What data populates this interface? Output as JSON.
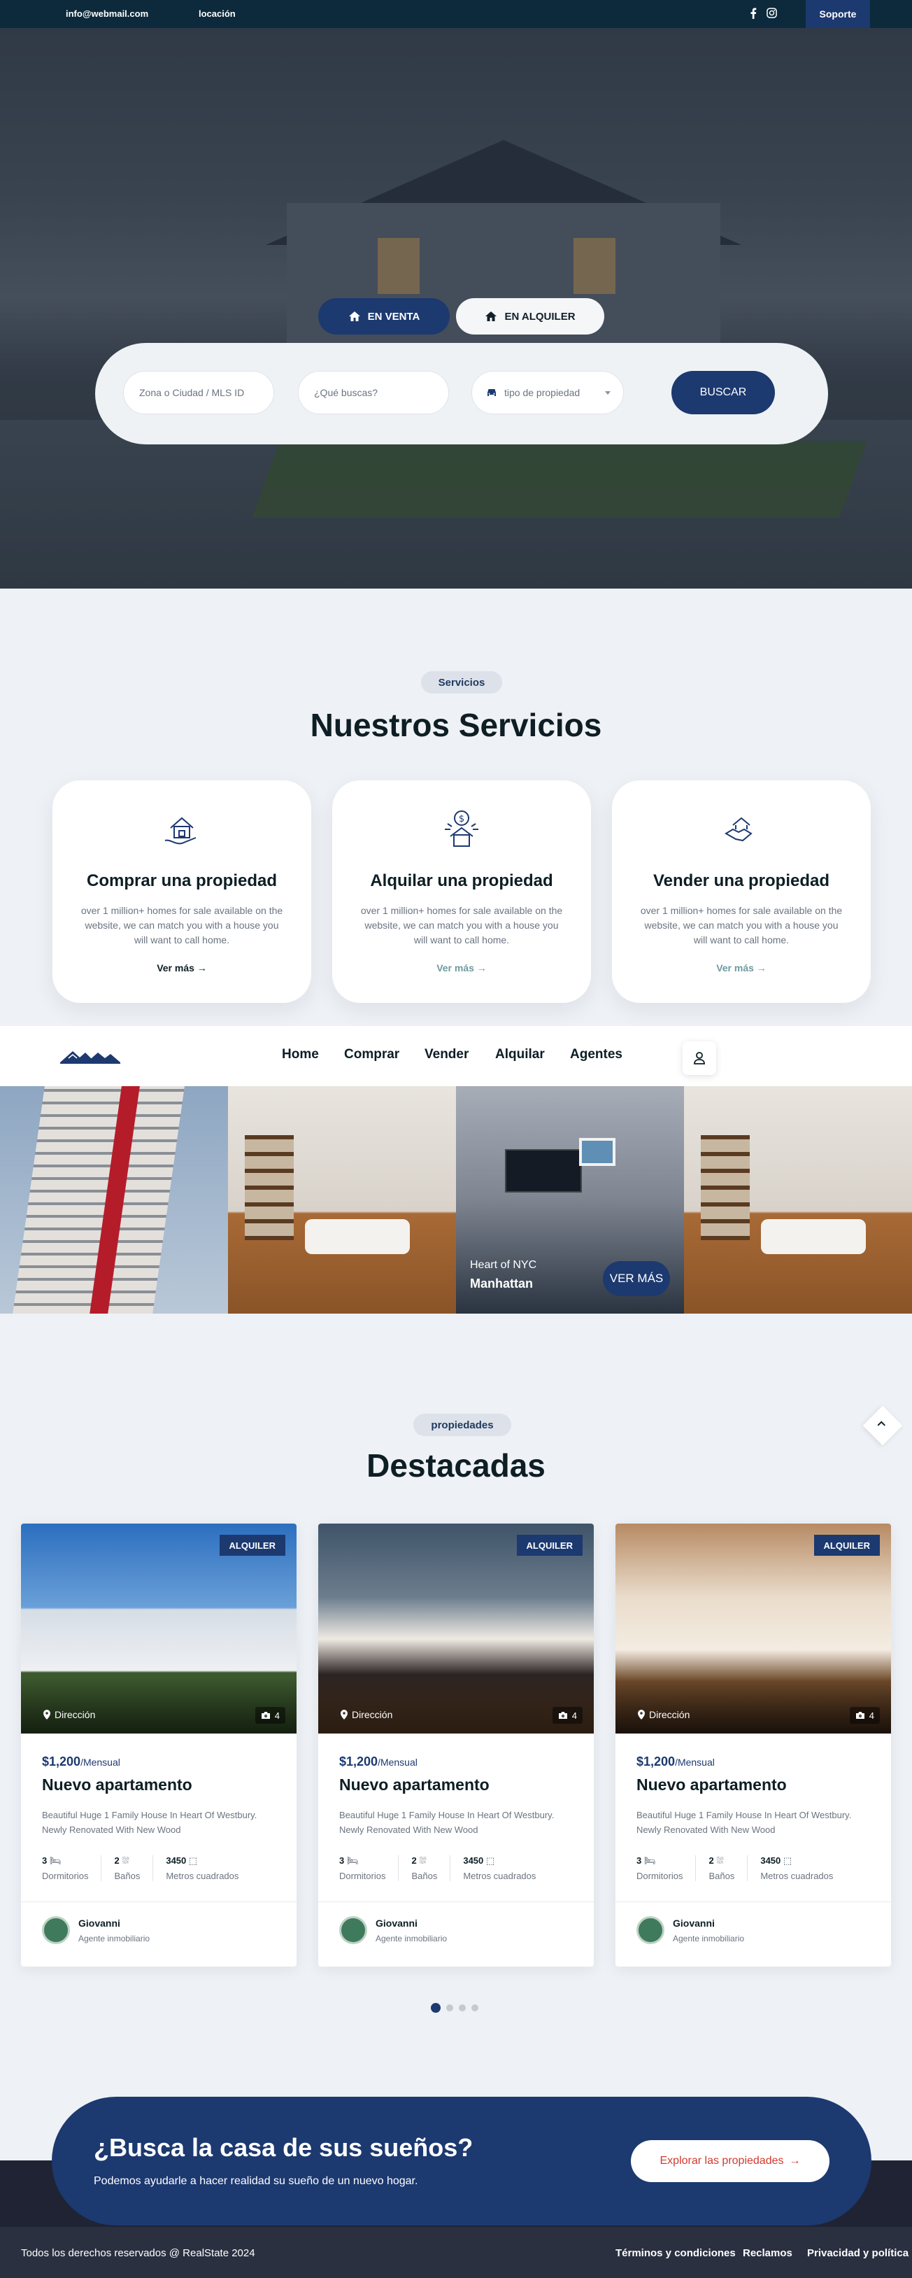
{
  "topbar": {
    "email": "info@webmail.com",
    "location": "locación",
    "support": "Soporte",
    "icons": [
      "mail-icon",
      "facebook-icon",
      "instagram-icon"
    ]
  },
  "hero": {
    "tab_sale": "EN VENTA",
    "tab_rent": "EN ALQUILER",
    "search": {
      "zone_placeholder": "Zona o Ciudad / MLS ID",
      "query_placeholder": "¿Qué buscas?",
      "property_type": "tipo de propiedad",
      "button": "BUSCAR"
    }
  },
  "services": {
    "pill": "Servicios",
    "title": "Nuestros Servicios",
    "cards": [
      {
        "title": "Comprar una propiedad",
        "desc": "over 1 million+ homes for sale available on the website, we can match you with a house you will want to call home.",
        "link": "Ver más"
      },
      {
        "title": "Alquilar una propiedad",
        "desc": "over 1 million+ homes for sale available on the website, we can match you with a house you will want to call home.",
        "link": "Ver más"
      },
      {
        "title": "Vender una propiedad",
        "desc": "over 1 million+ homes for sale available on the website, we can match you with a house you will want to call home.",
        "link": "Ver más"
      }
    ]
  },
  "nav": {
    "items": [
      "Home",
      "Comprar",
      "Vender",
      "Alquilar",
      "Agentes"
    ]
  },
  "gallery": {
    "caption_small": "Heart of NYC",
    "caption_big": "Manhattan",
    "button": "VER MÁS"
  },
  "featured": {
    "pill": "propiedades",
    "title": "Destacadas",
    "cards": [
      {
        "badge": "ALQUILER",
        "address": "Dirección",
        "photos": "4",
        "price": "$1,200",
        "period": "/Mensual",
        "title": "Nuevo apartamento",
        "desc": "Beautiful Huge 1 Family House In Heart Of Westbury. Newly Renovated With New Wood",
        "beds": "3",
        "beds_label": "Dormitorios",
        "baths": "2",
        "baths_label": "Baños",
        "area": "3450",
        "area_label": "Metros cuadrados",
        "agent": "Giovanni",
        "agent_role": "Agente inmobiliario"
      },
      {
        "badge": "ALQUILER",
        "address": "Dirección",
        "photos": "4",
        "price": "$1,200",
        "period": "/Mensual",
        "title": "Nuevo apartamento",
        "desc": "Beautiful Huge 1 Family House In Heart Of Westbury. Newly Renovated With New Wood",
        "beds": "3",
        "beds_label": "Dormitorios",
        "baths": "2",
        "baths_label": "Baños",
        "area": "3450",
        "area_label": "Metros cuadrados",
        "agent": "Giovanni",
        "agent_role": "Agente inmobiliario"
      },
      {
        "badge": "ALQUILER",
        "address": "Dirección",
        "photos": "4",
        "price": "$1,200",
        "period": "/Mensual",
        "title": "Nuevo apartamento",
        "desc": "Beautiful Huge 1 Family House In Heart Of Westbury. Newly Renovated With New Wood",
        "beds": "3",
        "beds_label": "Dormitorios",
        "baths": "2",
        "baths_label": "Baños",
        "area": "3450",
        "area_label": "Metros cuadrados",
        "agent": "Giovanni",
        "agent_role": "Agente inmobiliario"
      }
    ],
    "pagination": {
      "pages": 4,
      "active": 1
    }
  },
  "cta": {
    "title": "¿Busca la casa de sus sueños?",
    "subtitle": "Podemos ayudarle a hacer realidad su sueño de un nuevo hogar.",
    "button": "Explorar las propiedades"
  },
  "footer": {
    "copyright": "Todos los derechos reservados @ RealState 2024",
    "links": [
      "Términos y condiciones",
      "Reclamos",
      "Privacidad y política"
    ]
  },
  "colors": {
    "primary": "#1c3970",
    "topbar": "#0c2a3b",
    "cta_link": "#d23a2e",
    "footer": "#2b3040"
  }
}
